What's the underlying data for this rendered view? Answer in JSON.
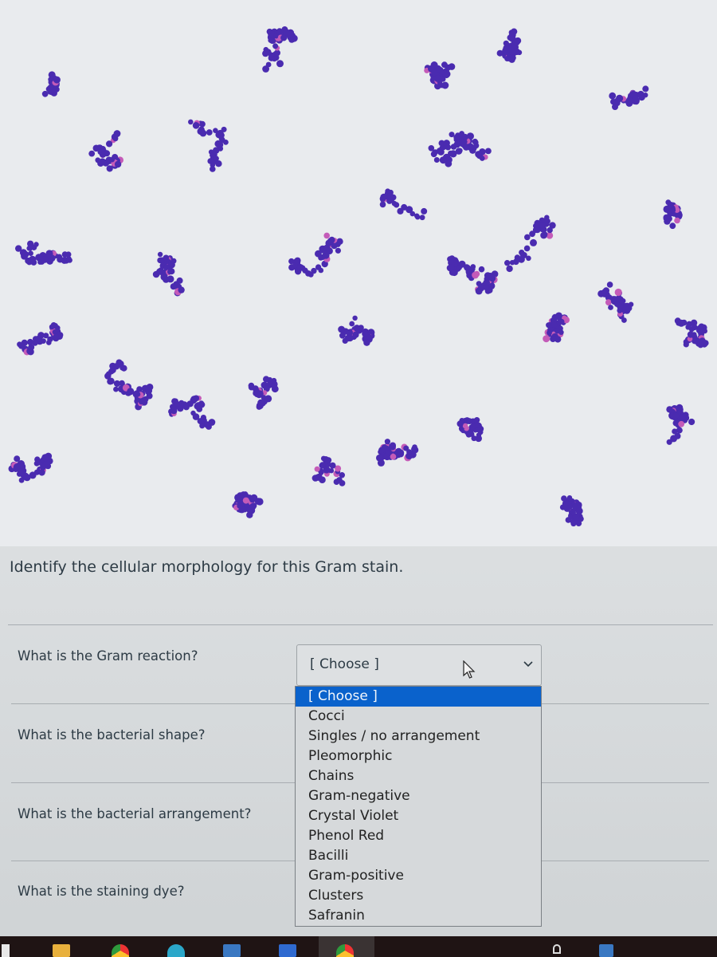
{
  "image": {
    "description": "Gram stain micrograph showing purple spherical cells in grape-like clusters",
    "stain_color": "#4a2bb0",
    "background_color": "#e9ebee"
  },
  "prompt": "Identify the cellular morphology for this Gram stain.",
  "questions": [
    {
      "label": "What is the Gram reaction?"
    },
    {
      "label": "What is the bacterial shape?"
    },
    {
      "label": "What is the bacterial arrangement?"
    },
    {
      "label": "What is the staining dye?"
    }
  ],
  "select": {
    "current_value": "[ Choose ]",
    "chevron_icon": "chevron-down-icon",
    "expanded": true
  },
  "dropdown": {
    "selected_index": 0,
    "highlight_color": "#0a62cc",
    "options": [
      "[ Choose ]",
      "Cocci",
      "Singles / no arrangement",
      "Pleomorphic",
      "Chains",
      "Gram-negative",
      "Crystal Violet",
      "Phenol Red",
      "Bacilli",
      "Gram-positive",
      "Clusters",
      "Safranin"
    ]
  },
  "cursor": {
    "icon": "mouse-pointer-icon"
  },
  "taskbar": {
    "icons": [
      "start-icon",
      "file-explorer-icon",
      "chrome-icon",
      "edge-icon",
      "store-icon",
      "word-icon",
      "chrome-icon",
      "network-icon",
      "battery-icon"
    ]
  }
}
